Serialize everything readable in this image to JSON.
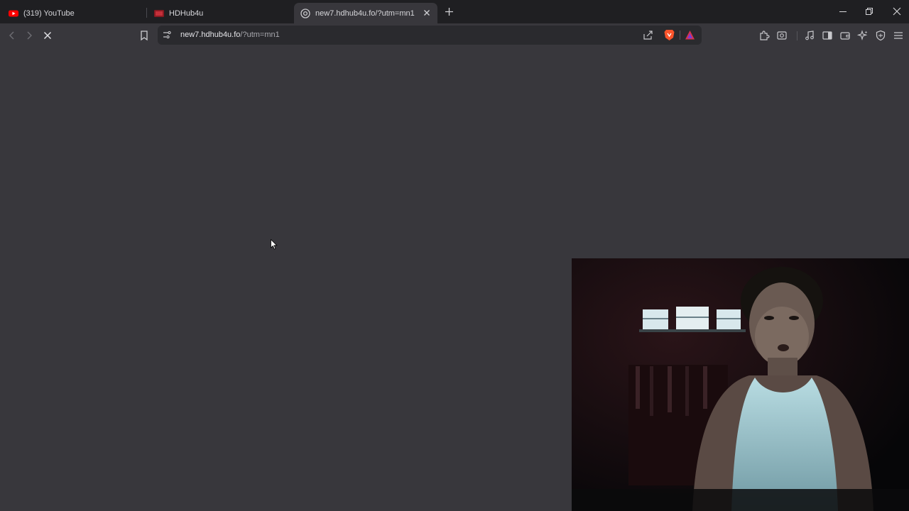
{
  "tabs": [
    {
      "label": "(319) YouTube",
      "icon": "youtube-icon"
    },
    {
      "label": "HDHub4u",
      "icon": "hdhub-favicon"
    },
    {
      "label": "new7.hdhub4u.fo/?utm=mn1",
      "icon": "globe-icon",
      "active": true
    }
  ],
  "address_bar": {
    "url_host": "new7.hdhub4u.fo",
    "url_path": "/?utm=mn1"
  },
  "colors": {
    "tabstrip_bg": "#1f1f22",
    "page_bg": "#38373c",
    "youtube_red": "#ff0000",
    "brave_orange": "#fb542b"
  },
  "page_state": "loading",
  "overlay": {
    "type": "webcam-video",
    "subject": "person"
  }
}
